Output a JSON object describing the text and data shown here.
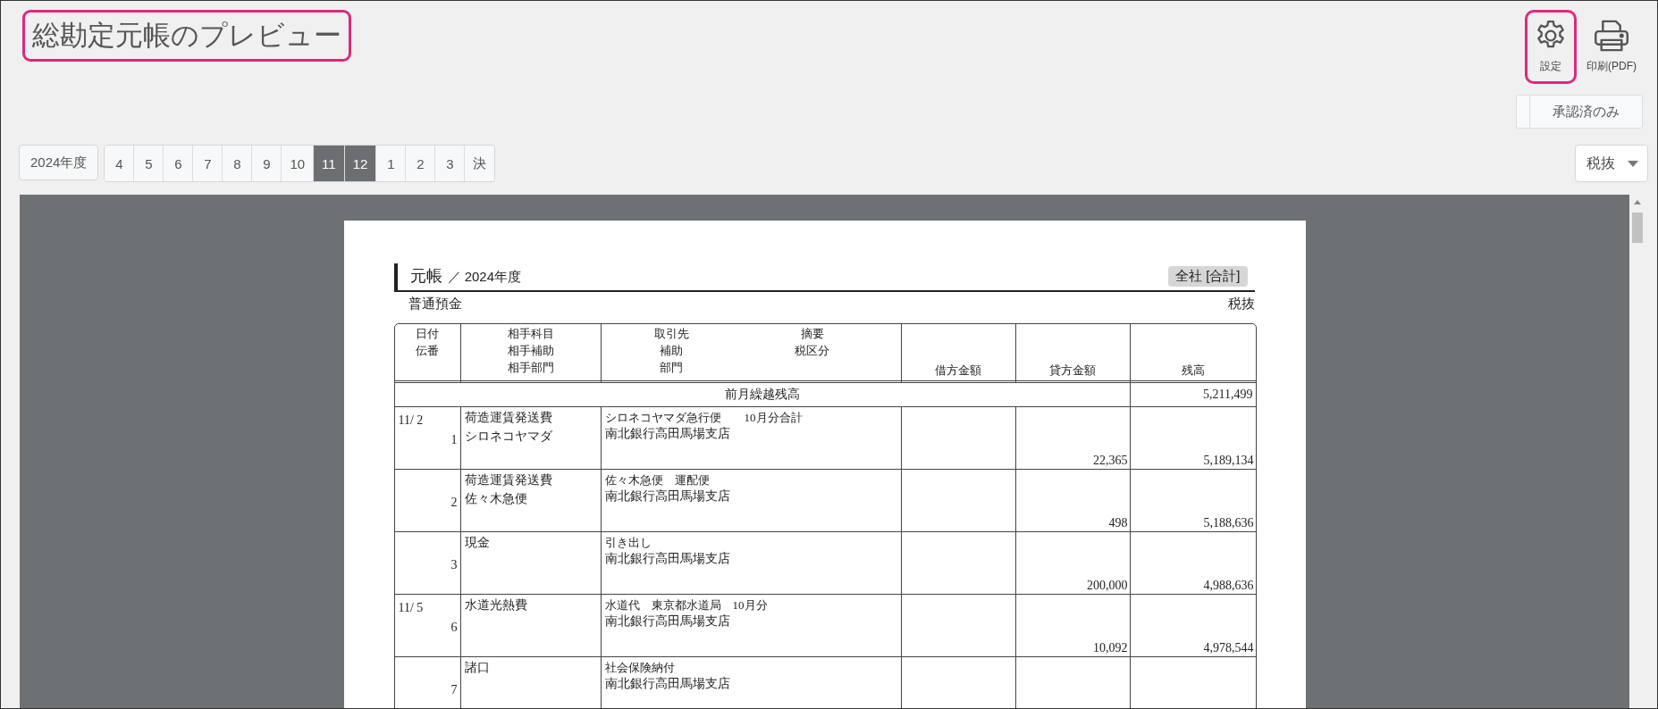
{
  "title": {
    "text": "総勘定元帳のプレビュー",
    "highlighted": true
  },
  "toolbar": [
    {
      "kind": "gear",
      "label": "設定",
      "highlighted": true
    },
    {
      "kind": "printer",
      "label": "印刷(PDF)",
      "highlighted": false
    }
  ],
  "approved_only": {
    "label": "承認済のみ",
    "checked": false
  },
  "period": {
    "year": "2024年度",
    "months": [
      {
        "label": "4",
        "selected": false
      },
      {
        "label": "5",
        "selected": false
      },
      {
        "label": "6",
        "selected": false
      },
      {
        "label": "7",
        "selected": false
      },
      {
        "label": "8",
        "selected": false
      },
      {
        "label": "9",
        "selected": false
      },
      {
        "label": "10",
        "selected": false
      },
      {
        "label": "11",
        "selected": true
      },
      {
        "label": "12",
        "selected": true
      },
      {
        "label": "1",
        "selected": false
      },
      {
        "label": "2",
        "selected": false
      },
      {
        "label": "3",
        "selected": false
      },
      {
        "label": "決",
        "selected": false
      }
    ]
  },
  "tax_select": {
    "value": "税抜"
  },
  "document": {
    "heading": "元帳",
    "year": "／ 2024年度",
    "scope": "全社 [合計]",
    "account": "普通預金",
    "tax": "税抜",
    "columns": [
      {
        "kind": "stacked",
        "lines": [
          "日付",
          "伝番"
        ]
      },
      {
        "kind": "stacked",
        "lines": [
          "相手科目",
          "相手補助",
          "相手部門"
        ]
      },
      {
        "kind": "split",
        "lines": [
          "取引先",
          "補助",
          "部門"
        ],
        "right_lines": [
          "摘要",
          "税区分"
        ]
      },
      {
        "kind": "bottom",
        "lines": [
          "借方金額"
        ]
      },
      {
        "kind": "bottom",
        "lines": [
          "貸方金額"
        ]
      },
      {
        "kind": "bottom",
        "lines": [
          "残高"
        ]
      }
    ],
    "carry_forward": {
      "label": "前月繰越残高",
      "balance": "5,211,499"
    },
    "rows": [
      {
        "date": "11/ 2",
        "voucher": "1",
        "counter": [
          "荷造運賃発送費",
          "シロネコヤマダ"
        ],
        "description": "シロネコヤマダ急行便　　10月分合計",
        "sub": "南北銀行高田馬場支店",
        "credit": "22,365",
        "balance": "5,189,134"
      },
      {
        "voucher": "2",
        "counter": [
          "荷造運賃発送費",
          "佐々木急便"
        ],
        "description": "佐々木急便　運配便",
        "sub": "南北銀行高田馬場支店",
        "credit": "498",
        "balance": "5,188,636"
      },
      {
        "voucher": "3",
        "counter": [
          "現金"
        ],
        "description": "引き出し",
        "sub": "南北銀行高田馬場支店",
        "credit": "200,000",
        "balance": "4,988,636"
      },
      {
        "date": "11/ 5",
        "voucher": "6",
        "counter": [
          "水道光熱費"
        ],
        "description": "水道代　東京都水道局　10月分",
        "sub": "南北銀行高田馬場支店",
        "credit": "10,092",
        "balance": "4,978,544"
      },
      {
        "voucher": "7",
        "counter": [
          "諸口"
        ],
        "description": "社会保険納付",
        "sub": "南北銀行高田馬場支店"
      }
    ]
  }
}
